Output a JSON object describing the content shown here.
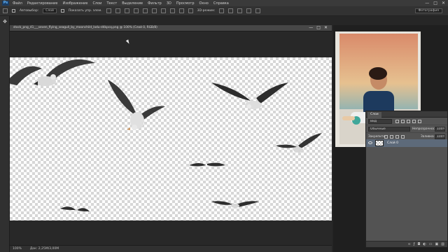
{
  "app": {
    "logo": "Ps"
  },
  "menu": [
    "Файл",
    "Редактирование",
    "Изображение",
    "Слои",
    "Текст",
    "Выделение",
    "Фильтр",
    "3D",
    "Просмотр",
    "Окно",
    "Справка"
  ],
  "window_controls": [
    "—",
    "□",
    "✕"
  ],
  "options_bar": {
    "autoselect_label": "Автовыбор:",
    "autoselect_value": "Слой",
    "show_controls_label": "Показать упр. элем.",
    "mode_3d_label": "3D-режим:",
    "workspace": "Фотография"
  },
  "document": {
    "tab_title": "stock_png_41___seven_flying_seagull_by_moonchild_ladu-d4kpcq.png @ 100% (Слой 0, RGB/8)",
    "buttons": [
      "—",
      "□",
      "✕"
    ]
  },
  "status": {
    "zoom": "100%",
    "doc_info": "Док: 2,25M/3,00M"
  },
  "layers_panel": {
    "tab": "Слои",
    "kind_filter": "Вид",
    "blend_mode": "Обычные",
    "opacity_label": "Непрозрачность:",
    "opacity_value": "100%",
    "lock_label": "Закрепить:",
    "fill_label": "Заливка:",
    "fill_value": "100%",
    "layer_name": "Слой 0",
    "bottom_icons": [
      "link-icon",
      "fx-icon",
      "mask-icon",
      "adjust-icon",
      "folder-icon",
      "new-layer-icon",
      "trash-icon"
    ]
  },
  "colors": {
    "accent": "#1b3d63",
    "panel": "#535353",
    "selected_layer": "#5d6a7a"
  }
}
